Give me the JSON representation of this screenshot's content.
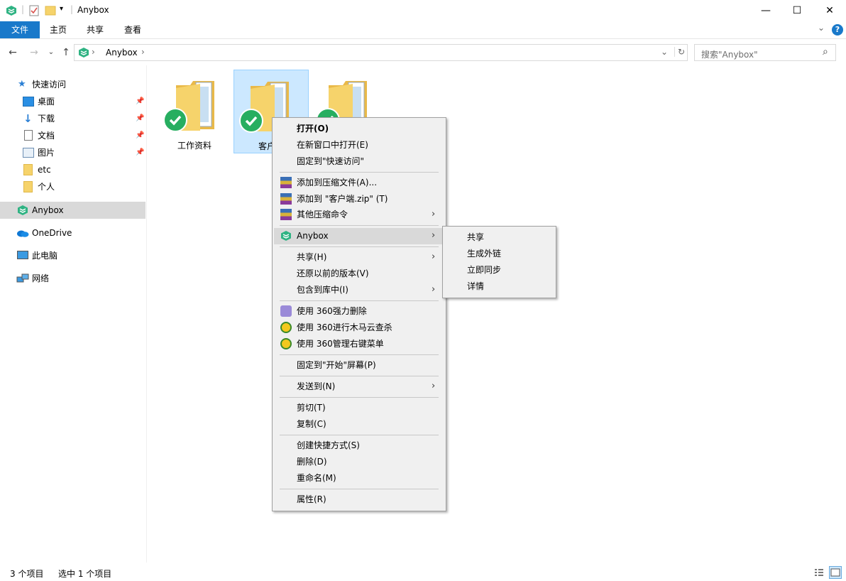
{
  "window": {
    "title": "Anybox",
    "minimize_glyph": "—",
    "maximize_glyph": "☐",
    "close_glyph": "✕",
    "title_separator": "|",
    "qat_dropdown_glyph": "▾"
  },
  "ribbon": {
    "tabs": [
      {
        "label": "文件"
      },
      {
        "label": "主页"
      },
      {
        "label": "共享"
      },
      {
        "label": "查看"
      }
    ],
    "expand_glyph": "⌄",
    "help_glyph": "?"
  },
  "nav": {
    "back_glyph": "←",
    "forward_glyph": "→",
    "recent_glyph": "⌄",
    "up_glyph": "↑",
    "breadcrumb": "Anybox",
    "breadcrumb_chevron": "›",
    "address_dropdown_glyph": "⌄",
    "refresh_glyph": "↻",
    "search_placeholder": "搜索\"Anybox\"",
    "search_glyph": "⌕"
  },
  "sidebar": {
    "pin_glyph": "📌",
    "quick_access": "快速访问",
    "quick_items": [
      {
        "label": "桌面",
        "icon": "desktop-icon",
        "pinned": true
      },
      {
        "label": "下载",
        "icon": "download-icon",
        "pinned": true
      },
      {
        "label": "文档",
        "icon": "document-icon",
        "pinned": true
      },
      {
        "label": "图片",
        "icon": "picture-icon",
        "pinned": true
      },
      {
        "label": "etc",
        "icon": "folder-icon",
        "pinned": false
      },
      {
        "label": "个人",
        "icon": "folder-icon",
        "pinned": false
      }
    ],
    "anybox": "Anybox",
    "onedrive": "OneDrive",
    "this_pc": "此电脑",
    "network": "网络"
  },
  "files": [
    {
      "name": "工作资料",
      "synced": true
    },
    {
      "name": "客户端",
      "synced": true
    },
    {
      "name": "",
      "synced": true
    }
  ],
  "context_menu": {
    "open": "打开(O)",
    "open_new_window": "在新窗口中打开(E)",
    "pin_quick_access": "固定到\"快速访问\"",
    "add_archive": "添加到压缩文件(A)...",
    "add_to_zip": "添加到 \"客户端.zip\" (T)",
    "other_compress": "其他压缩命令",
    "anybox": "Anybox",
    "share": "共享(H)",
    "restore_versions": "还原以前的版本(V)",
    "include_library": "包含到库中(I)",
    "del_360": "使用 360强力删除",
    "scan_360": "使用 360进行木马云查杀",
    "manage_360": "使用 360管理右键菜单",
    "pin_start": "固定到\"开始\"屏幕(P)",
    "send_to": "发送到(N)",
    "cut": "剪切(T)",
    "copy": "复制(C)",
    "create_shortcut": "创建快捷方式(S)",
    "delete": "删除(D)",
    "rename": "重命名(M)",
    "properties": "属性(R)",
    "submenu_glyph": "›"
  },
  "anybox_submenu": [
    {
      "label": "共享"
    },
    {
      "label": "生成外链"
    },
    {
      "label": "立即同步"
    },
    {
      "label": "详情"
    }
  ],
  "status": {
    "count": "3 个项目",
    "selection": "选中 1 个项目"
  },
  "colors": {
    "accent": "#1979ca",
    "anybox_green": "#2fb383",
    "sync_check": "#27ae60",
    "folder": "#f6d36b",
    "selection_bg": "#cce8ff"
  }
}
